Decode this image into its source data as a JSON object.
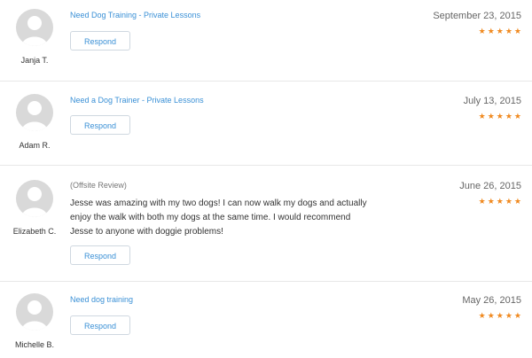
{
  "reviews": [
    {
      "name": "Janja T.",
      "title": "Need Dog Training - Private Lessons",
      "respond_label": "Respond",
      "date": "September 23, 2015",
      "rating": 5
    },
    {
      "name": "Adam R.",
      "title": "Need a Dog Trainer - Private Lessons",
      "respond_label": "Respond",
      "date": "July 13, 2015",
      "rating": 5
    },
    {
      "name": "Elizabeth C.",
      "source_note": "(Offsite Review)",
      "body": "Jesse was amazing with my two dogs! I can now walk my dogs and actually enjoy the walk with both my dogs at the same time. I would recommend Jesse to anyone with doggie problems!",
      "respond_label": "Respond",
      "date": "June 26, 2015",
      "rating": 5
    },
    {
      "name": "Michelle B.",
      "title": "Need dog training",
      "respond_label": "Respond",
      "date": "May 26, 2015",
      "rating": 5
    }
  ],
  "colors": {
    "link": "#3a90d6",
    "star": "#f0891f",
    "divider": "#e8e8e8"
  }
}
